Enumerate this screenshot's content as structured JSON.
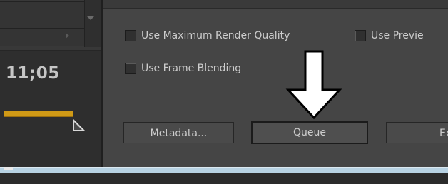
{
  "timeline": {
    "timecode": "11;05"
  },
  "export_options": {
    "checkboxes": [
      {
        "label": "Use Maximum Render Quality",
        "checked": false
      },
      {
        "label": "Use Previe",
        "checked": false
      },
      {
        "label": "Use Frame Blending",
        "checked": false
      }
    ],
    "buttons": {
      "metadata": "Metadata...",
      "queue": "Queue",
      "export": "Expo"
    }
  },
  "annotation": {
    "icon": "down-arrow-icon",
    "color": "#ffffff"
  },
  "colors": {
    "work_area_bar": "#d09a16",
    "panel_bg": "#454545",
    "bottom_strip": "#b7d2e3"
  }
}
